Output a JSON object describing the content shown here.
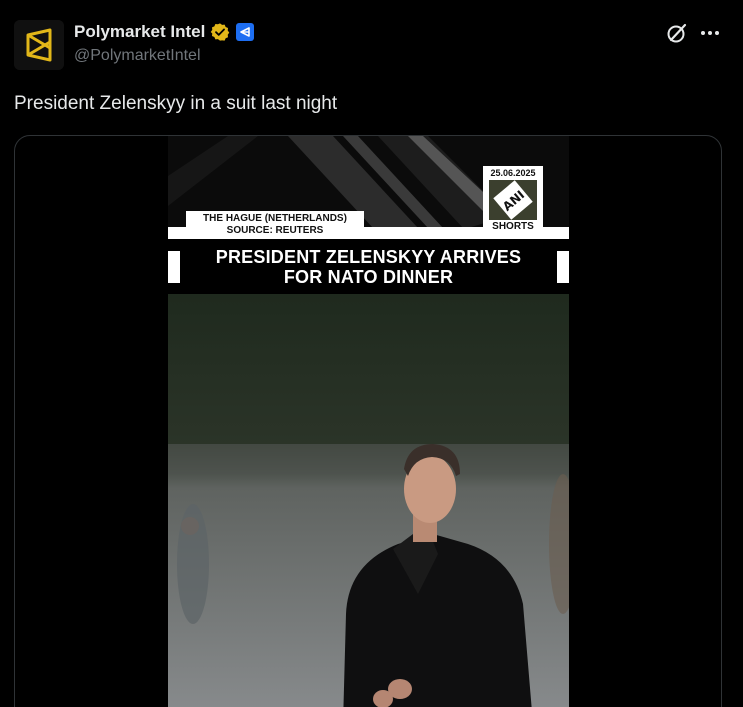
{
  "author": {
    "display_name": "Polymarket Intel",
    "handle": "@PolymarketIntel",
    "verified": true,
    "affiliate_badge": "affiliate-badge-icon",
    "avatar": "polymarket-logo"
  },
  "tweet": {
    "text": "President Zelenskyy in a suit last night"
  },
  "media": {
    "type": "video",
    "overlay": {
      "location_line1": "THE HAGUE (NETHERLANDS)",
      "location_line2": "SOURCE: REUTERS",
      "date": "25.06.2025",
      "logo_text": "ANI",
      "logo_label": "SHORTS",
      "headline_line1": "PRESIDENT ZELENSKYY ARRIVES",
      "headline_line2": "FOR NATO DINNER"
    }
  },
  "actions": {
    "grok_icon": "grok-icon",
    "more_icon": "more-icon"
  },
  "colors": {
    "background": "#000000",
    "text_primary": "#e7e9ea",
    "text_secondary": "#71767b",
    "verified_gold": "#e2b719",
    "affiliate_blue": "#1d6ef2",
    "headline_green": "#a3c22a"
  }
}
